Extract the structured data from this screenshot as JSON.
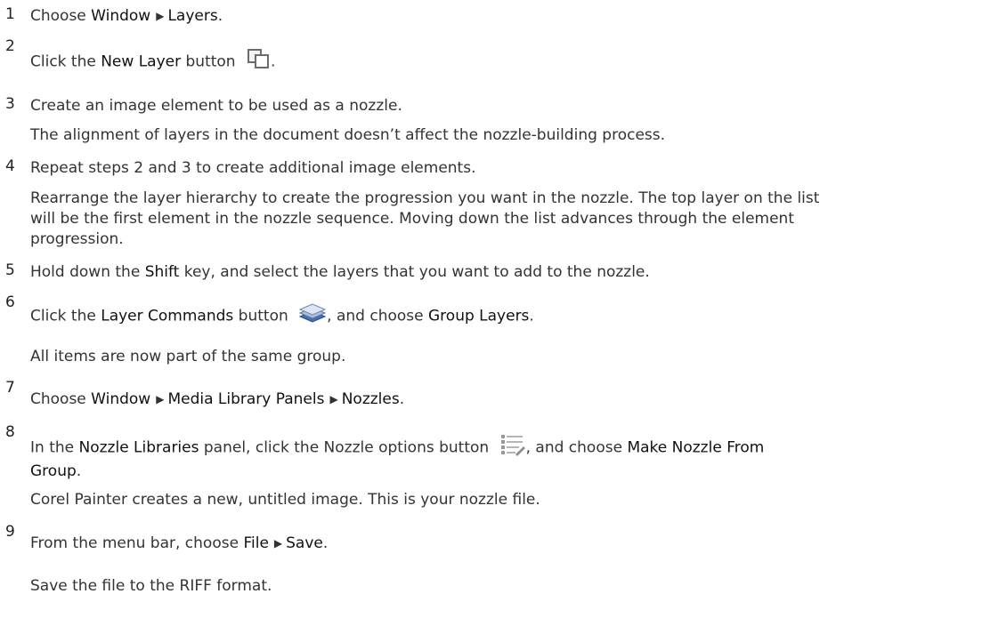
{
  "steps": [
    {
      "num": "1",
      "a": "Choose ",
      "w1": "Window",
      "arrow": "▶",
      "w2": "Layers",
      "end": "."
    },
    {
      "num": "2",
      "a": "Click the ",
      "w1": "New Layer",
      "b": " button",
      "end": "."
    },
    {
      "num": "3",
      "text": "Create an image element to be used as a nozzle.",
      "note": "The alignment of layers in the document doesn’t affect the nozzle-building process."
    },
    {
      "num": "4",
      "text": "Repeat steps 2 and 3 to create additional image elements.",
      "note1": "Rearrange the layer hierarchy to create the progression you want in the nozzle. The top layer on the list",
      "note2": "will be the first element in the nozzle sequence. Moving down the list advances through the element",
      "note3": "progression."
    },
    {
      "num": "5",
      "a": "Hold down the ",
      "w1": "Shift",
      "b": " key, and select the layers that you want to add to the nozzle."
    },
    {
      "num": "6",
      "a": "Click the ",
      "w1": "Layer Commands",
      "b": " button",
      "c": ", and choose ",
      "w2": "Group Layers",
      "end": ".",
      "note": "All items are now part of the same group."
    },
    {
      "num": "7",
      "a": "Choose ",
      "w1": "Window",
      "arrow1": "▶",
      "w2": "Media Library Panels",
      "arrow2": "▶",
      "w3": "Nozzles",
      "end": "."
    },
    {
      "num": "8",
      "a": "In the ",
      "w1": "Nozzle Libraries",
      "b": " panel, click the Nozzle options button",
      "c": ", and choose ",
      "w2": "Make Nozzle From",
      "w3": "Group",
      "end": ".",
      "note": "Corel Painter creates a new, untitled image. This is your nozzle file."
    },
    {
      "num": "9",
      "a": "From the menu bar, choose ",
      "w1": "File",
      "arrow": "▶",
      "w2": "Save",
      "end": ".",
      "note": "Save the file to the RIFF format."
    }
  ]
}
